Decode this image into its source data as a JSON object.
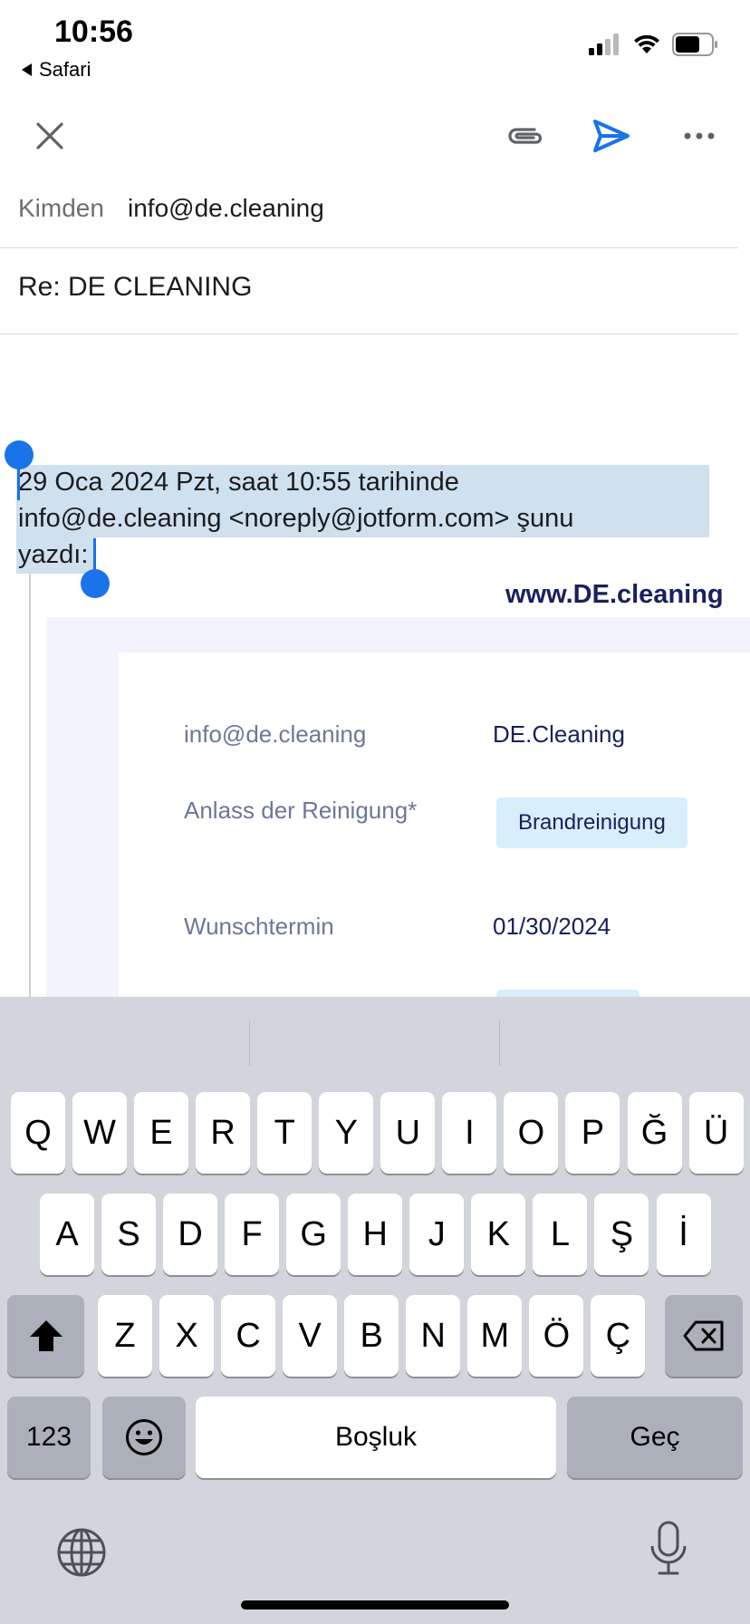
{
  "status_bar": {
    "time": "10:56",
    "back_app": "Safari"
  },
  "toolbar": {
    "close_icon": "close-icon",
    "attach_icon": "paperclip-icon",
    "send_icon": "send-icon",
    "more_icon": "more-icon",
    "send_color": "#1a73e8"
  },
  "compose": {
    "from_label": "Kimden",
    "from_value": "info@de.cleaning",
    "subject": "Re: DE CLEANING"
  },
  "quoted": {
    "line1": "29 Oca 2024 Pzt, saat 10:55 tarihinde",
    "line2": "info@de.cleaning <noreply@jotform.com> şunu",
    "line3": "yazdı:"
  },
  "email_body": {
    "site": "www.DE.cleaning",
    "rows": [
      {
        "label": "info@de.cleaning",
        "value": "DE.Cleaning"
      },
      {
        "label": "Anlass der Reinigung*",
        "value": "Brandreinigung"
      },
      {
        "label": "Wunschtermin",
        "value": "01/30/2024"
      }
    ]
  },
  "keyboard": {
    "row1": [
      "Q",
      "W",
      "E",
      "R",
      "T",
      "Y",
      "U",
      "I",
      "O",
      "P",
      "Ğ",
      "Ü"
    ],
    "row2": [
      "A",
      "S",
      "D",
      "F",
      "G",
      "H",
      "J",
      "K",
      "L",
      "Ş",
      "İ"
    ],
    "row3": [
      "Z",
      "X",
      "C",
      "V",
      "B",
      "N",
      "M",
      "Ö",
      "Ç"
    ],
    "numbers_key": "123",
    "space_key": "Boşluk",
    "return_key": "Geç",
    "shift_icon": "shift-icon",
    "delete_icon": "delete-icon",
    "emoji_icon": "emoji-icon",
    "globe_icon": "globe-icon",
    "mic_icon": "microphone-icon"
  }
}
